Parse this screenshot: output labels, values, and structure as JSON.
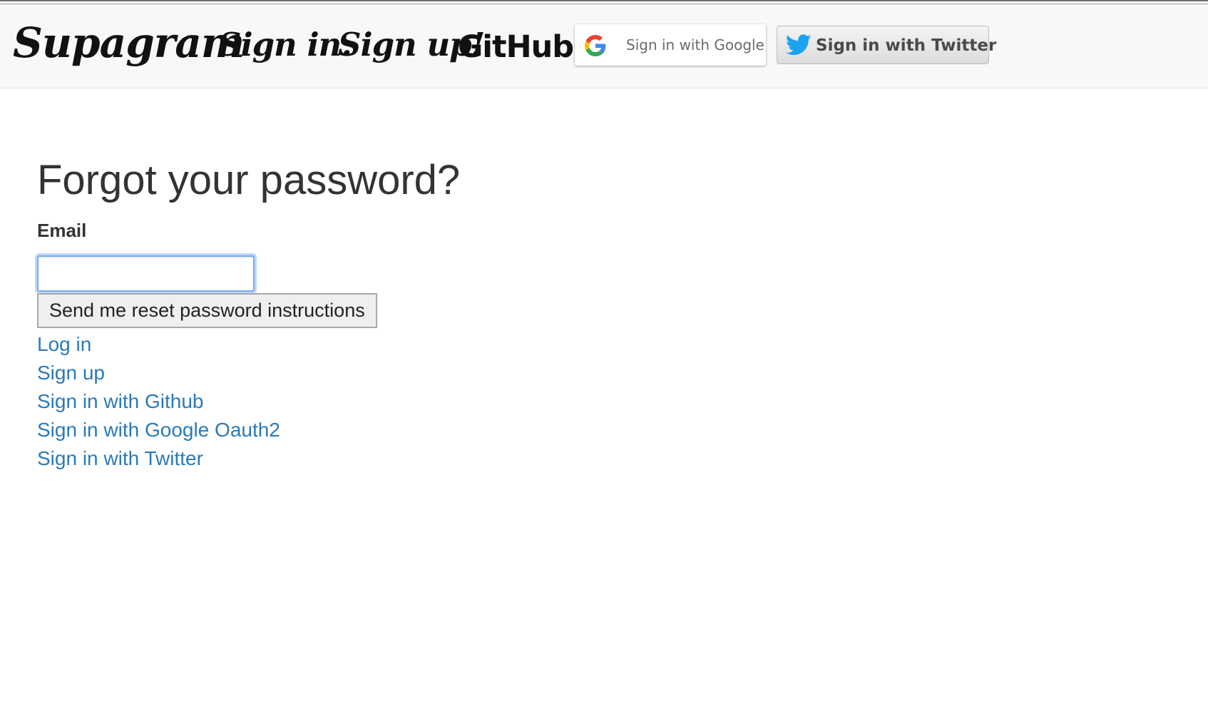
{
  "navbar": {
    "brand": "Supagram",
    "sign_in": "Sign in.",
    "sign_up": "Sign up!",
    "github": "GitHub",
    "google_button": {
      "label": "Sign in with Google",
      "icon": "google-g-icon"
    },
    "twitter_button": {
      "label": "Sign in with Twitter",
      "icon": "twitter-bird-icon"
    }
  },
  "main": {
    "title": "Forgot your password?",
    "email_label": "Email",
    "email_value": "",
    "submit_label": "Send me reset password instructions",
    "links": [
      "Log in",
      "Sign up",
      "Sign in with Github",
      "Sign in with Google Oauth2",
      "Sign in with Twitter"
    ]
  },
  "colors": {
    "link": "#2a7ab8",
    "twitter_blue": "#1da1f2",
    "navbar_bg": "#f8f8f8",
    "focus_ring": "#78aef0"
  }
}
